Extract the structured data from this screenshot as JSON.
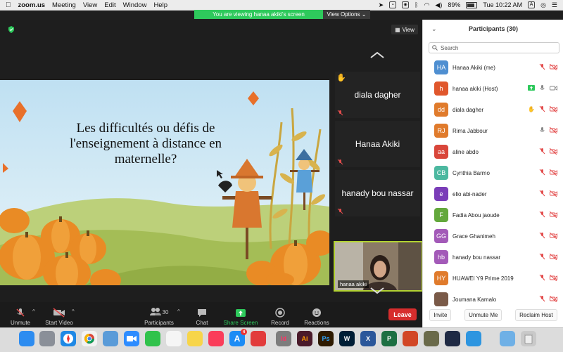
{
  "menubar": {
    "app_name": "zoom.us",
    "menus": [
      "Meeting",
      "View",
      "Edit",
      "Window",
      "Help"
    ],
    "battery": "89%",
    "clock": "Tue 10:22 AM",
    "input_badge": "A"
  },
  "banner": {
    "message": "You are viewing hanaa akiki's screen",
    "options_label": "View Options"
  },
  "meeting": {
    "view_label": "View",
    "slide_title": "Les difficultés ou défis de l'enseignement à distance en maternelle?",
    "thumbnails": [
      "diala dagher",
      "Hanaa Akiki",
      "hanady bou nassar"
    ],
    "self_video_name": "hanaa akiki"
  },
  "toolbar": {
    "unmute": "Unmute",
    "start_video": "Start Video",
    "participants": "Participants",
    "participants_count": "30",
    "chat": "Chat",
    "share_screen": "Share Screen",
    "record": "Record",
    "reactions": "Reactions",
    "leave": "Leave"
  },
  "panel": {
    "title": "Participants (30)",
    "search_placeholder": "Search",
    "participants": [
      {
        "initials": "HA",
        "name": "Hanaa Akiki (me)",
        "color": "#4f8fd1"
      },
      {
        "initials": "h",
        "name": "hanaa akiki (Host)",
        "color": "#e0572c"
      },
      {
        "initials": "dd",
        "name": "diala dagher",
        "color": "#e07b2c"
      },
      {
        "initials": "RJ",
        "name": "Rima Jabbour",
        "color": "#e07b2c"
      },
      {
        "initials": "aa",
        "name": "aline abdo",
        "color": "#d9463a"
      },
      {
        "initials": "CB",
        "name": "Cynthia Barmo",
        "color": "#4cb8a0"
      },
      {
        "initials": "e",
        "name": "elio abi-nader",
        "color": "#7a3db8"
      },
      {
        "initials": "F",
        "name": "Fadia Abou jaoude",
        "color": "#63a83c"
      },
      {
        "initials": "GG",
        "name": "Grace Ghanimeh",
        "color": "#a35ab8"
      },
      {
        "initials": "hb",
        "name": "hanady bou nassar",
        "color": "#a35ab8"
      },
      {
        "initials": "HY",
        "name": "HUAWEI Y9 Prime 2019",
        "color": "#e07b2c"
      },
      {
        "initials": "",
        "name": "Joumana Kamalo",
        "color": "#7a5a48"
      }
    ],
    "footer": {
      "invite": "Invite",
      "unmute_me": "Unmute Me",
      "reclaim_host": "Reclaim Host"
    }
  },
  "dock": {
    "icons": [
      "finder-icon",
      "launchpad-icon",
      "safari-icon",
      "chrome-icon",
      "preview-icon",
      "zoom-icon",
      "facetime-icon",
      "photos-icon",
      "notes-icon",
      "music-icon",
      "appstore-icon",
      "anydesk-icon",
      "system-preferences-icon",
      "indesign-icon",
      "illustrator-icon",
      "photoshop-icon",
      "word-icon",
      "excel-icon",
      "powerpoint-icon",
      "game-icon",
      "quicktime-icon",
      "accessibility-icon",
      "folder-icon",
      "trash-icon"
    ],
    "labels": {
      "indesign": "Id",
      "illustrator": "Ai",
      "photoshop": "Ps",
      "word": "W",
      "excel": "X",
      "powerpoint": "P"
    },
    "appstore_badge": "4"
  }
}
